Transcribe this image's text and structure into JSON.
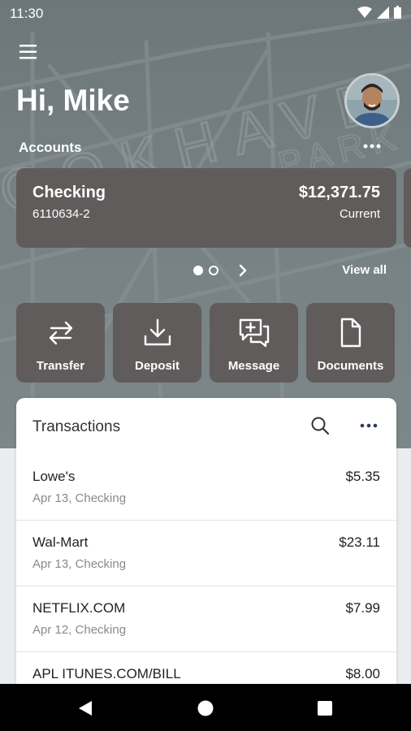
{
  "status_bar": {
    "time": "11:30"
  },
  "header": {
    "greeting": "Hi, Mike"
  },
  "accounts": {
    "label": "Accounts",
    "cards": [
      {
        "name": "Checking",
        "number": "6110634-2",
        "balance": "$12,371.75",
        "balance_label": "Current"
      }
    ],
    "view_all": "View all",
    "page_index": 1,
    "page_count": 2
  },
  "quick_actions": [
    {
      "label": "Transfer",
      "icon": "transfer-arrows-icon"
    },
    {
      "label": "Deposit",
      "icon": "download-tray-icon"
    },
    {
      "label": "Message",
      "icon": "chat-plus-icon"
    },
    {
      "label": "Documents",
      "icon": "document-icon"
    }
  ],
  "transactions": {
    "title": "Transactions",
    "items": [
      {
        "merchant": "Lowe's",
        "meta": "Apr 13, Checking",
        "amount": "$5.35"
      },
      {
        "merchant": "Wal-Mart",
        "meta": "Apr 13, Checking",
        "amount": "$23.11"
      },
      {
        "merchant": "NETFLIX.COM",
        "meta": "Apr 12, Checking",
        "amount": "$7.99"
      },
      {
        "merchant": "APL ITUNES.COM/BILL",
        "meta": "",
        "amount": "$8.00"
      }
    ]
  },
  "background_sign": {
    "line1": "OOKHAVE",
    "line2": "PARK"
  },
  "colors": {
    "card": "#615c5c",
    "hero_bg": "#737d7f",
    "panel_bg": "#ffffff",
    "muted_text": "#8a8a8a"
  }
}
